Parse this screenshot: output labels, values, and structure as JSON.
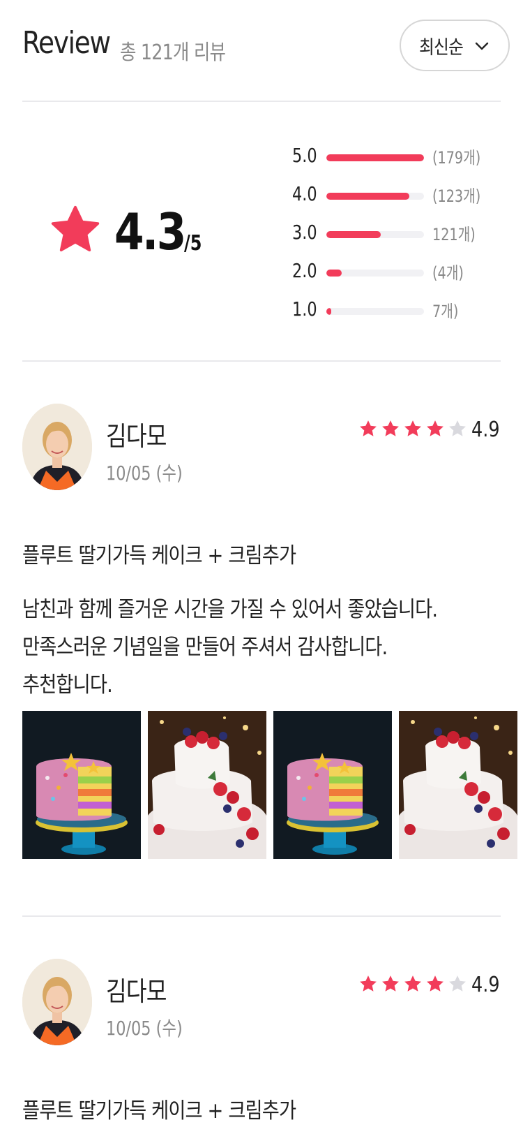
{
  "header": {
    "title": "Review",
    "total": "총 121개 리뷰",
    "sort_label": "최신순"
  },
  "summary": {
    "average": "4.3",
    "max": "/5",
    "distribution": [
      {
        "score": "5.0",
        "count": "(179개)",
        "fraction": 1.0
      },
      {
        "score": "4.0",
        "count": "(123개)",
        "fraction": 0.85
      },
      {
        "score": "3.0",
        "count": "121개)",
        "fraction": 0.56
      },
      {
        "score": "2.0",
        "count": "(4개)",
        "fraction": 0.16
      },
      {
        "score": "1.0",
        "count": "7개)",
        "fraction": 0.05
      }
    ]
  },
  "reviews": [
    {
      "name": "김다모",
      "date": "10/05 (수)",
      "stars_filled": 4,
      "score": "4.9",
      "product": "플루트 딸기가득 케이크 + 크림추가",
      "body": [
        "남친과 함께 즐거운 시간을 가질 수 있어서 좋았습니다.",
        "만족스러운 기념일을 만들어 주셔서 감사합니다.",
        "추천합니다."
      ],
      "photos": [
        "layer-cake-photo",
        "strawberry-cake-photo",
        "layer-cake-photo",
        "strawberry-cake-photo"
      ]
    },
    {
      "name": "김다모",
      "date": "10/05 (수)",
      "stars_filled": 4,
      "score": "4.9",
      "product": "플루트 딸기가득 케이크 + 크림추가"
    }
  ],
  "colors": {
    "accent": "#f23c5a",
    "star_empty": "#d9d9de",
    "muted_text": "#8a8a8a",
    "divider": "#e9e9ec"
  }
}
